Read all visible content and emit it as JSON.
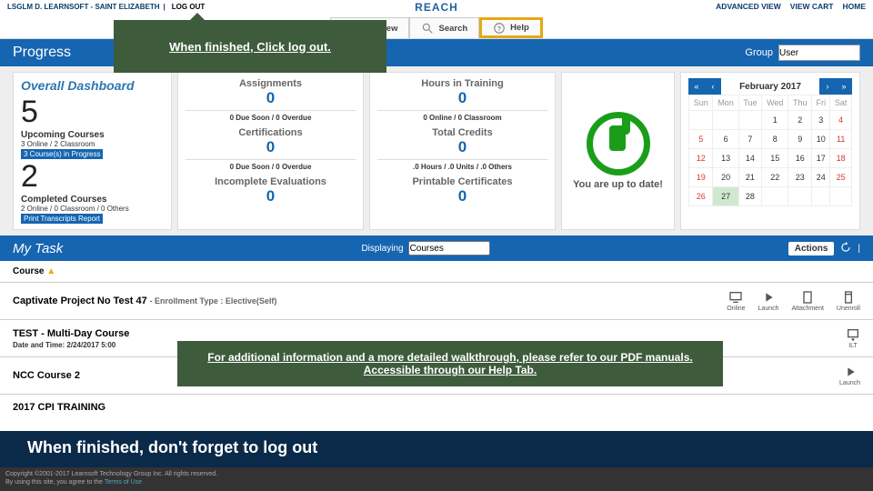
{
  "top": {
    "user": "LSGLM D. LEARNSOFT - SAINT ELIZABETH",
    "logout": "LOG OUT",
    "brand": "REACH",
    "links": [
      "ADVANCED VIEW",
      "VIEW CART",
      "HOME"
    ]
  },
  "nav": {
    "overview": "Overview",
    "search": "Search",
    "help": "Help"
  },
  "progress": {
    "title": "Progress",
    "group_label": "Group",
    "group_value": "User"
  },
  "dashboard": {
    "title": "Overall Dashboard",
    "upcoming_n": "5",
    "upcoming_lbl": "Upcoming Courses",
    "upcoming_sub": "3 Online / 2 Classroom",
    "progress_pill": "3 Course(s) in Progress",
    "completed_n": "2",
    "completed_lbl": "Completed Courses",
    "completed_sub": "2 Online / 0 Classroom / 0 Others",
    "print_pill": "Print Transcripts Report",
    "assign_t": "Assignments",
    "assign_n": "0",
    "assign_s": "0 Due Soon / 0 Overdue",
    "cert_t": "Certifications",
    "cert_n": "0",
    "cert_s": "0 Due Soon / 0 Overdue",
    "eval_t": "Incomplete Evaluations",
    "eval_n": "0",
    "hours_t": "Hours in Training",
    "hours_n": "0",
    "hours_s": "0 Online / 0 Classroom",
    "credits_t": "Total Credits",
    "credits_n": "0",
    "credits_s": ".0 Hours / .0 Units / .0 Others",
    "printc_t": "Printable Certificates",
    "printc_n": "0",
    "uptodate": "You are up to date!"
  },
  "calendar": {
    "month": "February 2017",
    "dow": [
      "Sun",
      "Mon",
      "Tue",
      "Wed",
      "Thu",
      "Fri",
      "Sat"
    ]
  },
  "mytask": {
    "title": "My Task",
    "displaying": "Displaying",
    "disp_value": "Courses",
    "actions": "Actions"
  },
  "list": {
    "header": "Course",
    "row1_title": "Captivate Project No Test 47",
    "row1_enroll": "- Enrollment Type : Elective(Self)",
    "row2_title": "TEST - Multi-Day Course",
    "row2_date": "Date and Time: 2/24/2017 5:00",
    "row3_title": "NCC Course 2",
    "row4_title": "2017 CPI TRAINING",
    "icons": {
      "online": "Online",
      "launch": "Launch",
      "attach": "Attachment",
      "unenroll": "Unenroll",
      "ilt": "ILT"
    }
  },
  "callout1": "When finished, Click log out.",
  "callout2": "For additional information and a more detailed walkthrough, please refer to our PDF manuals. Accessible through our Help Tab.",
  "footer": "When finished, don't forget to log out",
  "copy": {
    "l1": "Copyright ©2001-2017 Learnsoft Technology Group Inc. All rights reserved.",
    "l2": "By using this site, you agree to the ",
    "terms": "Terms of Use"
  }
}
